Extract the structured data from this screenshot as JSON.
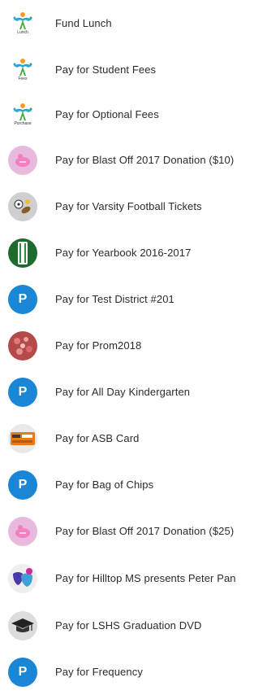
{
  "items": [
    {
      "label": "Fund Lunch",
      "icon": "school-logo-icon",
      "caption": "Lunch"
    },
    {
      "label": "Pay for Student Fees",
      "icon": "school-logo-icon",
      "caption": "Fees"
    },
    {
      "label": "Pay for Optional Fees",
      "icon": "school-logo-icon",
      "caption": "Purchase"
    },
    {
      "label": "Pay for Blast Off 2017 Donation ($10)",
      "icon": "pink-piggy-icon"
    },
    {
      "label": "Pay for Varsity Football Tickets",
      "icon": "sports-balls-icon"
    },
    {
      "label": "Pay for Yearbook 2016-2017",
      "icon": "yearbook-icon"
    },
    {
      "label": "Pay for Test District #201",
      "icon": "letter-avatar-icon",
      "letter": "P"
    },
    {
      "label": "Pay for Prom2018",
      "icon": "prom-icon"
    },
    {
      "label": "Pay for All Day Kindergarten",
      "icon": "letter-avatar-icon",
      "letter": "P"
    },
    {
      "label": "Pay for ASB Card",
      "icon": "asb-card-icon"
    },
    {
      "label": "Pay for Bag of Chips",
      "icon": "letter-avatar-icon",
      "letter": "P"
    },
    {
      "label": "Pay for Blast Off 2017 Donation ($25)",
      "icon": "pink-piggy-icon"
    },
    {
      "label": "Pay for Hilltop MS presents Peter Pan",
      "icon": "masks-icon"
    },
    {
      "label": "Pay for LSHS Graduation DVD",
      "icon": "graduation-cap-icon"
    },
    {
      "label": "Pay for Frequency",
      "icon": "letter-avatar-icon",
      "letter": "P"
    }
  ],
  "colors": {
    "avatar_blue": "#1a86d6",
    "text": "#2b2b2b",
    "background": "#ffffff"
  }
}
